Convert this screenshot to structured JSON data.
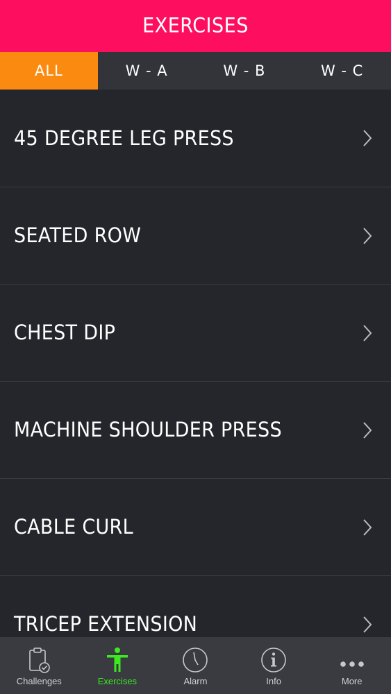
{
  "header": {
    "title": "EXERCISES"
  },
  "tabs": [
    {
      "label": "ALL",
      "active": true
    },
    {
      "label": "W - A",
      "active": false
    },
    {
      "label": "W - B",
      "active": false
    },
    {
      "label": "W - C",
      "active": false
    }
  ],
  "exercises": [
    {
      "label": "45 DEGREE LEG PRESS"
    },
    {
      "label": "SEATED ROW"
    },
    {
      "label": "CHEST DIP"
    },
    {
      "label": "MACHINE SHOULDER PRESS"
    },
    {
      "label": "CABLE CURL"
    },
    {
      "label": "TRICEP EXTENSION"
    }
  ],
  "tabbar": {
    "items": [
      {
        "label": "Challenges",
        "icon": "clipboard-check-icon",
        "active": false
      },
      {
        "label": "Exercises",
        "icon": "person-icon",
        "active": true
      },
      {
        "label": "Alarm",
        "icon": "clock-icon",
        "active": false
      },
      {
        "label": "Info",
        "icon": "info-icon",
        "active": false
      },
      {
        "label": "More",
        "icon": "more-dots-icon",
        "active": false
      }
    ]
  },
  "colors": {
    "header_bg": "#fe0e5f",
    "tab_active_bg": "#fa8a10",
    "tab_bar_active": "#3bea1f",
    "background": "#25262b"
  }
}
